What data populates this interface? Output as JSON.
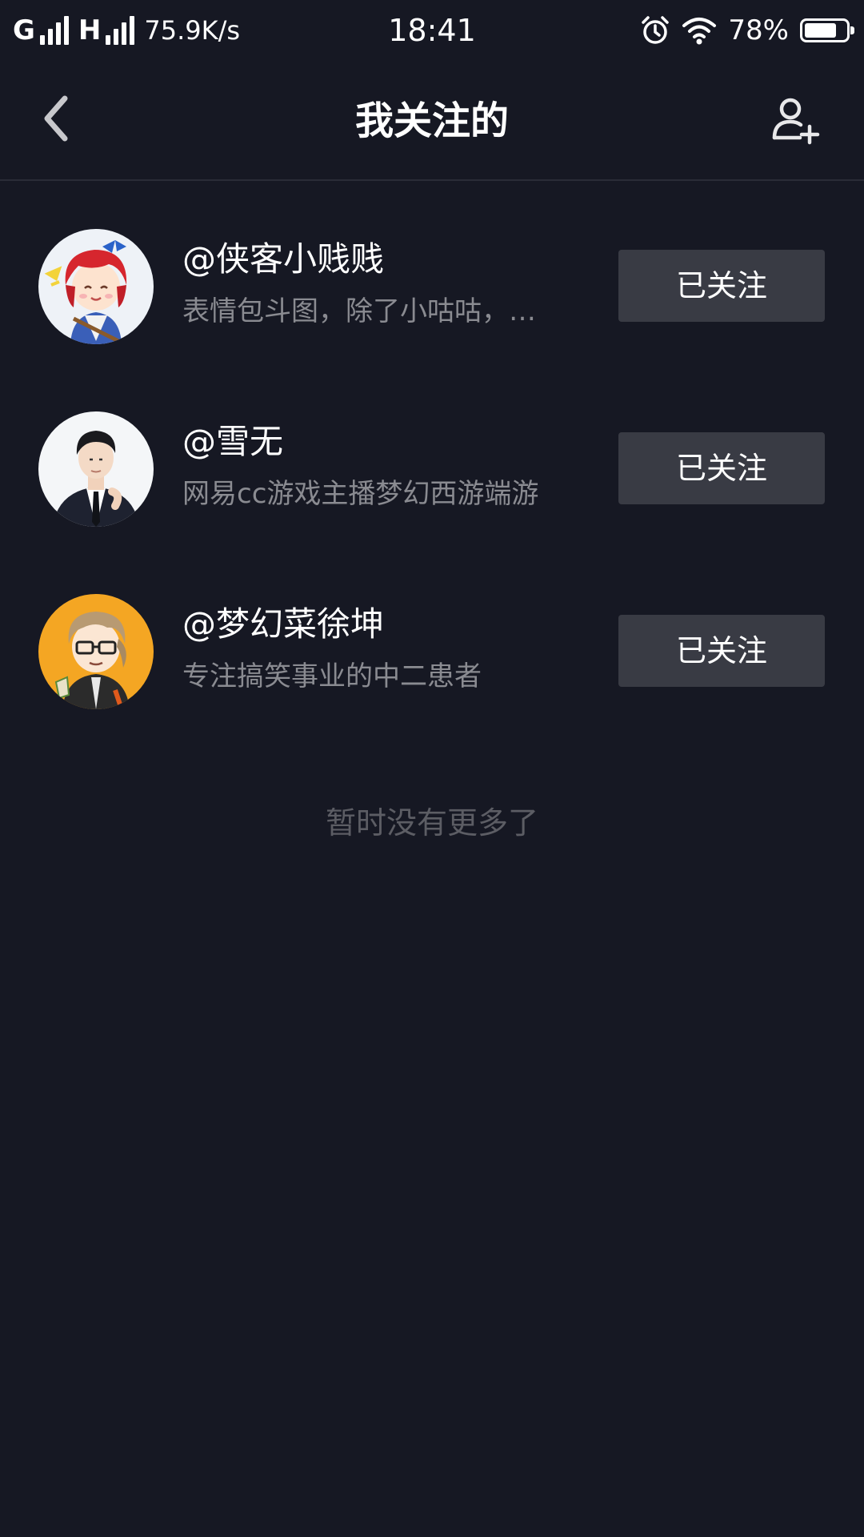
{
  "status_bar": {
    "network1": "G",
    "network2": "H",
    "speed": "75.9K/s",
    "time": "18:41",
    "battery_text": "78%",
    "battery_level": 0.78,
    "icons": [
      "signal-icon",
      "alarm-icon",
      "wifi-icon",
      "battery-icon"
    ]
  },
  "nav": {
    "title": "我关注的",
    "back_icon": "chevron-left-icon",
    "add_icon": "add-user-icon"
  },
  "following": [
    {
      "name": "@侠客小贱贱",
      "bio": "表情包斗图，除了小咕咕，…",
      "button": "已关注",
      "avatar": "anime-red-hair-avatar"
    },
    {
      "name": "@雪无",
      "bio": "网易cc游戏主播梦幻西游端游",
      "button": "已关注",
      "avatar": "man-in-suit-avatar"
    },
    {
      "name": "@梦幻菜徐坤",
      "bio": "专注搞笑事业的中二患者",
      "button": "已关注",
      "avatar": "cartoon-glasses-avatar"
    }
  ],
  "end_hint": "暂时没有更多了",
  "colors": {
    "background": "#161823",
    "button_bg": "#393b44",
    "secondary_text": "#8a8b91",
    "hint_text": "#5c5d64"
  }
}
